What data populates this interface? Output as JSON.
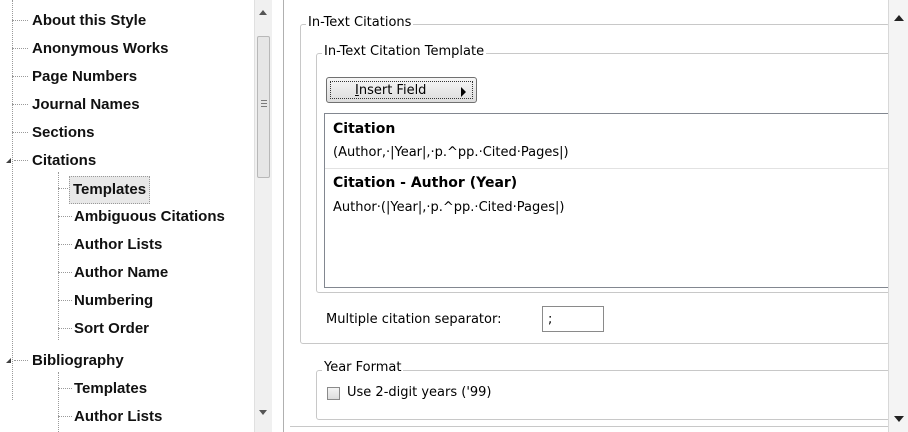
{
  "tree": {
    "items": [
      {
        "label": "About this Style",
        "level": 1
      },
      {
        "label": "Anonymous Works",
        "level": 1
      },
      {
        "label": "Page Numbers",
        "level": 1
      },
      {
        "label": "Journal Names",
        "level": 1
      },
      {
        "label": "Sections",
        "level": 1
      },
      {
        "label": "Citations",
        "level": 1,
        "expanded": true
      },
      {
        "label": "Templates",
        "level": 2,
        "selected": true
      },
      {
        "label": "Ambiguous Citations",
        "level": 2
      },
      {
        "label": "Author Lists",
        "level": 2
      },
      {
        "label": "Author Name",
        "level": 2
      },
      {
        "label": "Numbering",
        "level": 2
      },
      {
        "label": "Sort Order",
        "level": 2
      },
      {
        "label": "Bibliography",
        "level": 1,
        "expanded": true
      },
      {
        "label": "Templates",
        "level": 2
      },
      {
        "label": "Author Lists",
        "level": 2
      }
    ]
  },
  "panel": {
    "group_title": "In-Text Citations",
    "template_group_title": "In-Text Citation Template",
    "insert_button": {
      "mnemonic": "I",
      "rest": "nsert Field"
    },
    "template": {
      "citation_heading": "Citation",
      "citation_line": "(Author,·|Year|,·p.^pp.·Cited·Pages|)",
      "author_year_heading": "Citation - Author (Year)",
      "author_year_line": "Author·(|Year|,·p.^pp.·Cited·Pages|)"
    },
    "separator_label": "Multiple citation separator:",
    "separator_value": ";",
    "year_group_title": "Year Format",
    "year_checkbox_label": "Use 2-digit years ('99)",
    "year_checkbox_checked": false
  },
  "colors": {
    "tree_text": "#111111",
    "selected_bg": "#e8e8e8",
    "border": "#828790"
  }
}
